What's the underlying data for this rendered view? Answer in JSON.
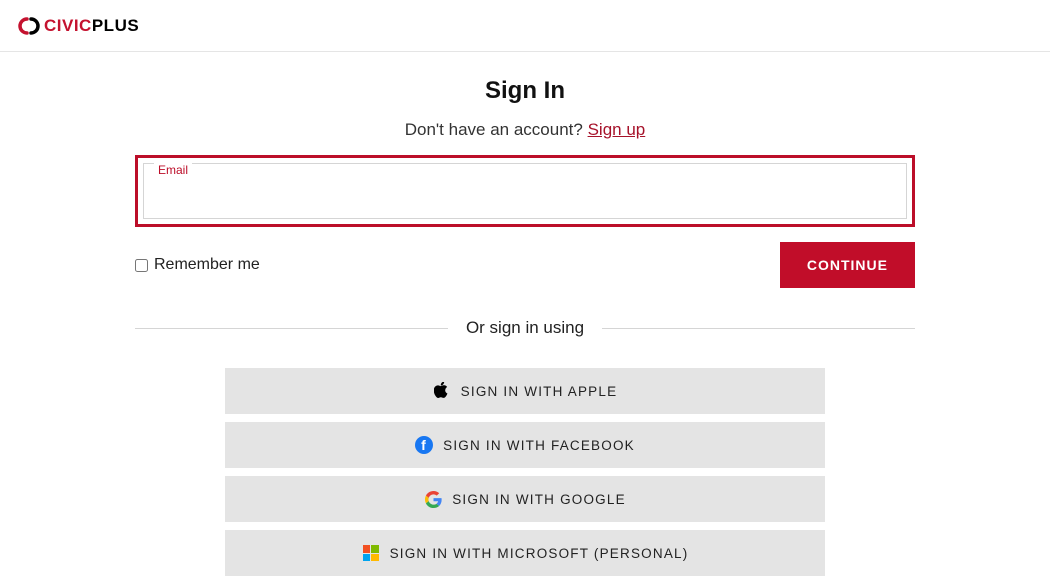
{
  "header": {
    "logo_brand_part1": "CIVIC",
    "logo_brand_part2": "PLUS"
  },
  "main": {
    "title": "Sign In",
    "subtitle_text": "Don't have an account? ",
    "signup_link": "Sign up",
    "email_label": "Email",
    "remember_label": "Remember me",
    "continue_label": "CONTINUE",
    "divider_text": "Or sign in using",
    "social": {
      "apple": "SIGN IN WITH APPLE",
      "facebook": "SIGN IN WITH FACEBOOK",
      "google": "SIGN IN WITH GOOGLE",
      "microsoft": "SIGN IN WITH MICROSOFT (PERSONAL)"
    }
  },
  "colors": {
    "brand": "#c4122f",
    "accent": "#bc0e29",
    "button": "#c10d29"
  }
}
